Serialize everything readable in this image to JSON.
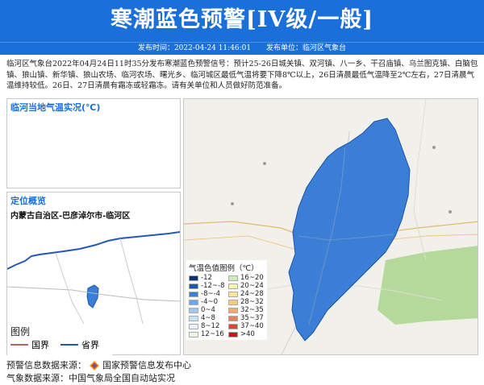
{
  "header": {
    "title": "寒潮蓝色预警[IV级/一般]"
  },
  "subbar": {
    "time_label": "发布时间：2022-04-24 11:46:01",
    "unit_label": "发布单位：临河区气象台"
  },
  "content": {
    "text": "临河区气象台2022年04月24日11时35分发布寒潮蓝色预警信号：预计25-26日城关镇、双河镇、八一乡、干召庙镇、乌兰图克镇、白脑包镇、狼山镇、新华镇、狼山农场、临河农场、曙光乡、临河城区最低气温将要下降8℃以上，26日清晨最低气温降至2℃左右，27日清晨气温维持较低。26日、27日清晨有霜冻或轻霜冻。请有关单位和人员做好防范准备。"
  },
  "temp_panel": {
    "title": "临河当地气温实况(℃)"
  },
  "locate_panel": {
    "title": "定位概览",
    "path": "内蒙古自治区-巴彦淖尔市-临河区",
    "legend_title": "图例",
    "legend_items": [
      {
        "label": "国界",
        "color": "#c0605a"
      },
      {
        "label": "省界",
        "color": "#2457b8"
      }
    ]
  },
  "color_legend": {
    "title": "气温色值图例（℃）",
    "items": [
      {
        "label": "-12",
        "color": "#0b2f7a"
      },
      {
        "label": "16~20",
        "color": "#c9efb6"
      },
      {
        "label": "-12~-8",
        "color": "#1d55a8"
      },
      {
        "label": "20~24",
        "color": "#f4f6a8"
      },
      {
        "label": "-8~-4",
        "color": "#3b7ed6"
      },
      {
        "label": "24~28",
        "color": "#fde39a"
      },
      {
        "label": "-4~0",
        "color": "#6aa6ec"
      },
      {
        "label": "28~32",
        "color": "#fcca7e"
      },
      {
        "label": "0~4",
        "color": "#9ec9f4"
      },
      {
        "label": "32~35",
        "color": "#f9a76a"
      },
      {
        "label": "4~8",
        "color": "#c7e2fb"
      },
      {
        "label": "35~37",
        "color": "#f47b53"
      },
      {
        "label": "8~12",
        "color": "#e4f3fd"
      },
      {
        "label": "37~40",
        "color": "#e24330"
      },
      {
        "label": "12~16",
        "color": "#eaf7e2"
      },
      {
        "label": ">40",
        "color": "#c4161c"
      }
    ]
  },
  "footer": {
    "source_label": "预警信息数据来源：",
    "source_name": "国家预警信息发布中心",
    "data_label": "气象数据来源：中国气象局全国自动站实况"
  }
}
